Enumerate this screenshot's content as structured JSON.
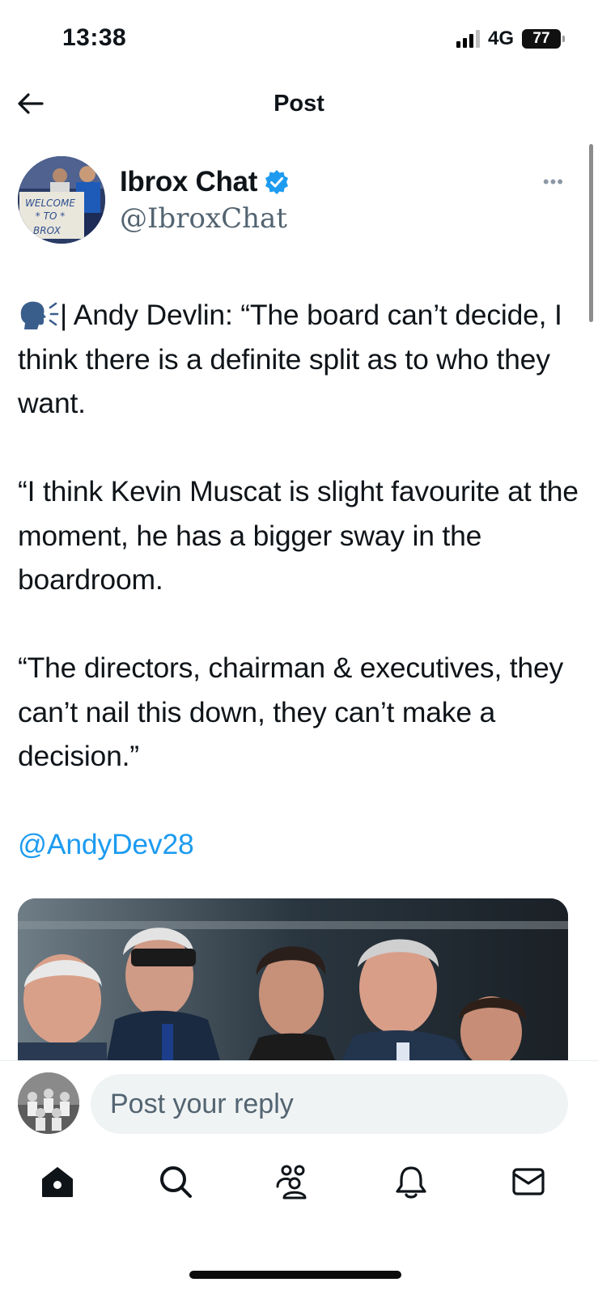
{
  "status_bar": {
    "time": "13:38",
    "network": "4G",
    "battery": "77"
  },
  "header": {
    "title": "Post"
  },
  "post": {
    "author": {
      "name": "Ibrox Chat",
      "handle": "@IbroxChat",
      "verified": true,
      "avatar_sign": [
        "WELCOME",
        "* TO *",
        "BROX"
      ]
    },
    "lines": {
      "p1": "| Andy Devlin: “The board can’t decide, I think there is a definite split as to who they want.",
      "p2": "“I think Kevin Muscat is slight favourite at the moment, he has a bigger sway in the boardroom.",
      "p3": "“The directors, chairman & executives, they can’t nail this down, they can’t make a decision.”",
      "mention": "@AndyDev28"
    }
  },
  "reply": {
    "placeholder": "Post your reply"
  },
  "tabs": [
    "home-icon",
    "search-icon",
    "communities-icon",
    "notifications-icon",
    "messages-icon"
  ],
  "colors": {
    "accent": "#1d9bf0",
    "text": "#0f1419",
    "secondary": "#536471"
  }
}
